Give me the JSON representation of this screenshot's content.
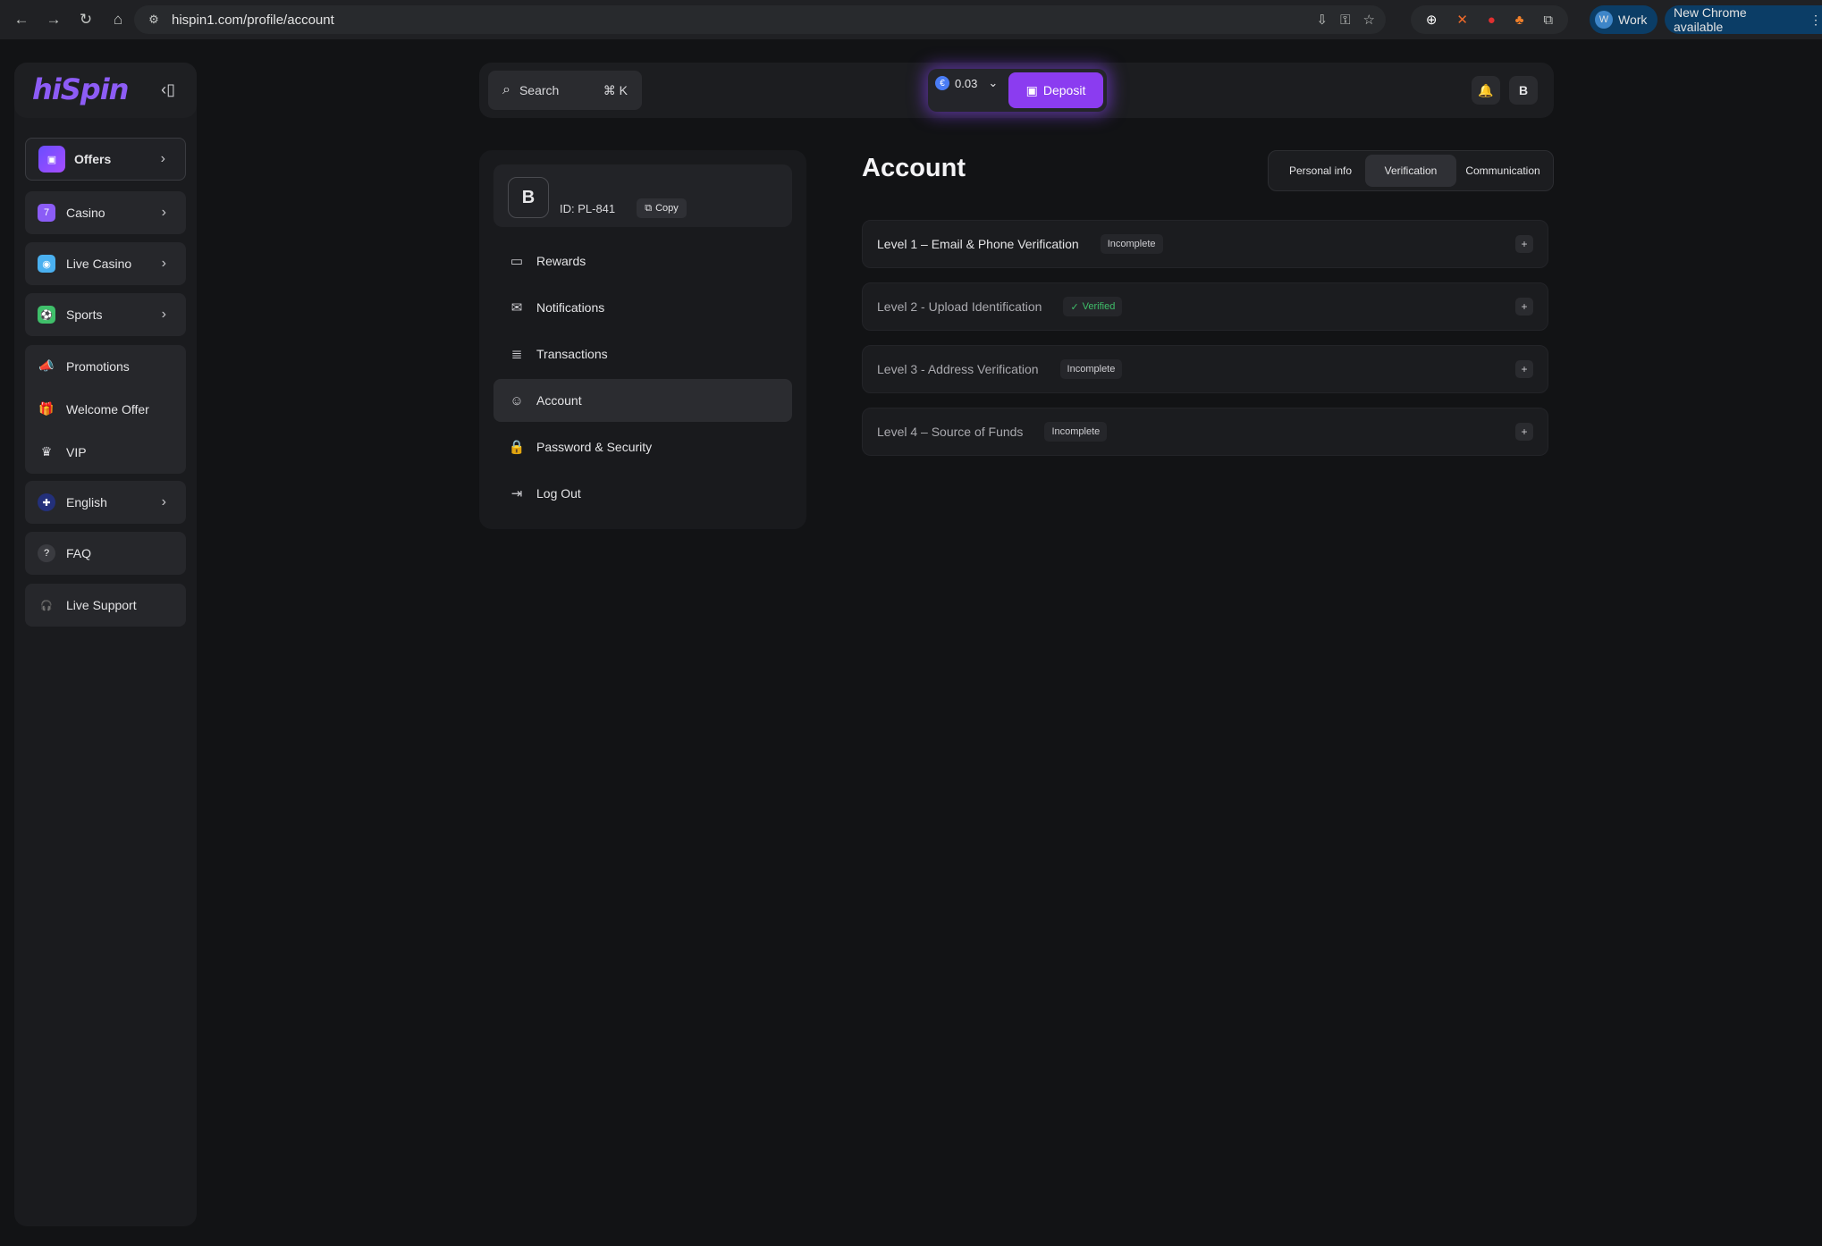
{
  "browser": {
    "url": "hispin1.com/profile/account",
    "profile_label": "Work",
    "profile_initial": "W",
    "update_label": "New Chrome available"
  },
  "sidebar": {
    "logo": "hiSpin",
    "offers_label": "Offers",
    "nav": [
      {
        "label": "Casino",
        "icon": "casino-icon",
        "color": "#8b5cf6"
      },
      {
        "label": "Live Casino",
        "icon": "live-casino-icon",
        "color": "#4ab0f0"
      },
      {
        "label": "Sports",
        "icon": "sports-icon",
        "color": "#3fbf6a"
      }
    ],
    "promo_group": [
      {
        "label": "Promotions",
        "icon": "megaphone-icon"
      },
      {
        "label": "Welcome Offer",
        "icon": "gift-icon"
      },
      {
        "label": "VIP",
        "icon": "crown-icon"
      }
    ],
    "language_label": "English",
    "faq_label": "FAQ",
    "support_label": "Live Support"
  },
  "topbar": {
    "search_label": "Search",
    "search_shortcut": "⌘ K",
    "balance": "0.03",
    "currency_symbol": "€",
    "deposit_label": "Deposit",
    "avatar_initial": "B"
  },
  "profile": {
    "avatar_initial": "B",
    "user_id": "ID: PL-841",
    "copy_label": "Copy",
    "menu": [
      {
        "label": "Rewards",
        "icon": "wallet-icon"
      },
      {
        "label": "Notifications",
        "icon": "inbox-icon"
      },
      {
        "label": "Transactions",
        "icon": "receipt-icon"
      },
      {
        "label": "Account",
        "icon": "user-icon"
      },
      {
        "label": "Password & Security",
        "icon": "lock-icon"
      },
      {
        "label": "Log Out",
        "icon": "logout-icon"
      }
    ]
  },
  "account": {
    "title": "Account",
    "tabs": [
      "Personal info",
      "Verification",
      "Communication"
    ],
    "active_tab": "Verification",
    "levels": [
      {
        "label": "Level 1 – Email & Phone Verification",
        "status": "Incomplete"
      },
      {
        "label": "Level 2 - Upload Identification",
        "status": "Verified"
      },
      {
        "label": "Level 3 - Address Verification",
        "status": "Incomplete"
      },
      {
        "label": "Level 4 – Source of Funds",
        "status": "Incomplete"
      }
    ]
  },
  "colors": {
    "accent": "#8b3cf0",
    "verified": "#3fbf6a",
    "background": "#121315"
  }
}
